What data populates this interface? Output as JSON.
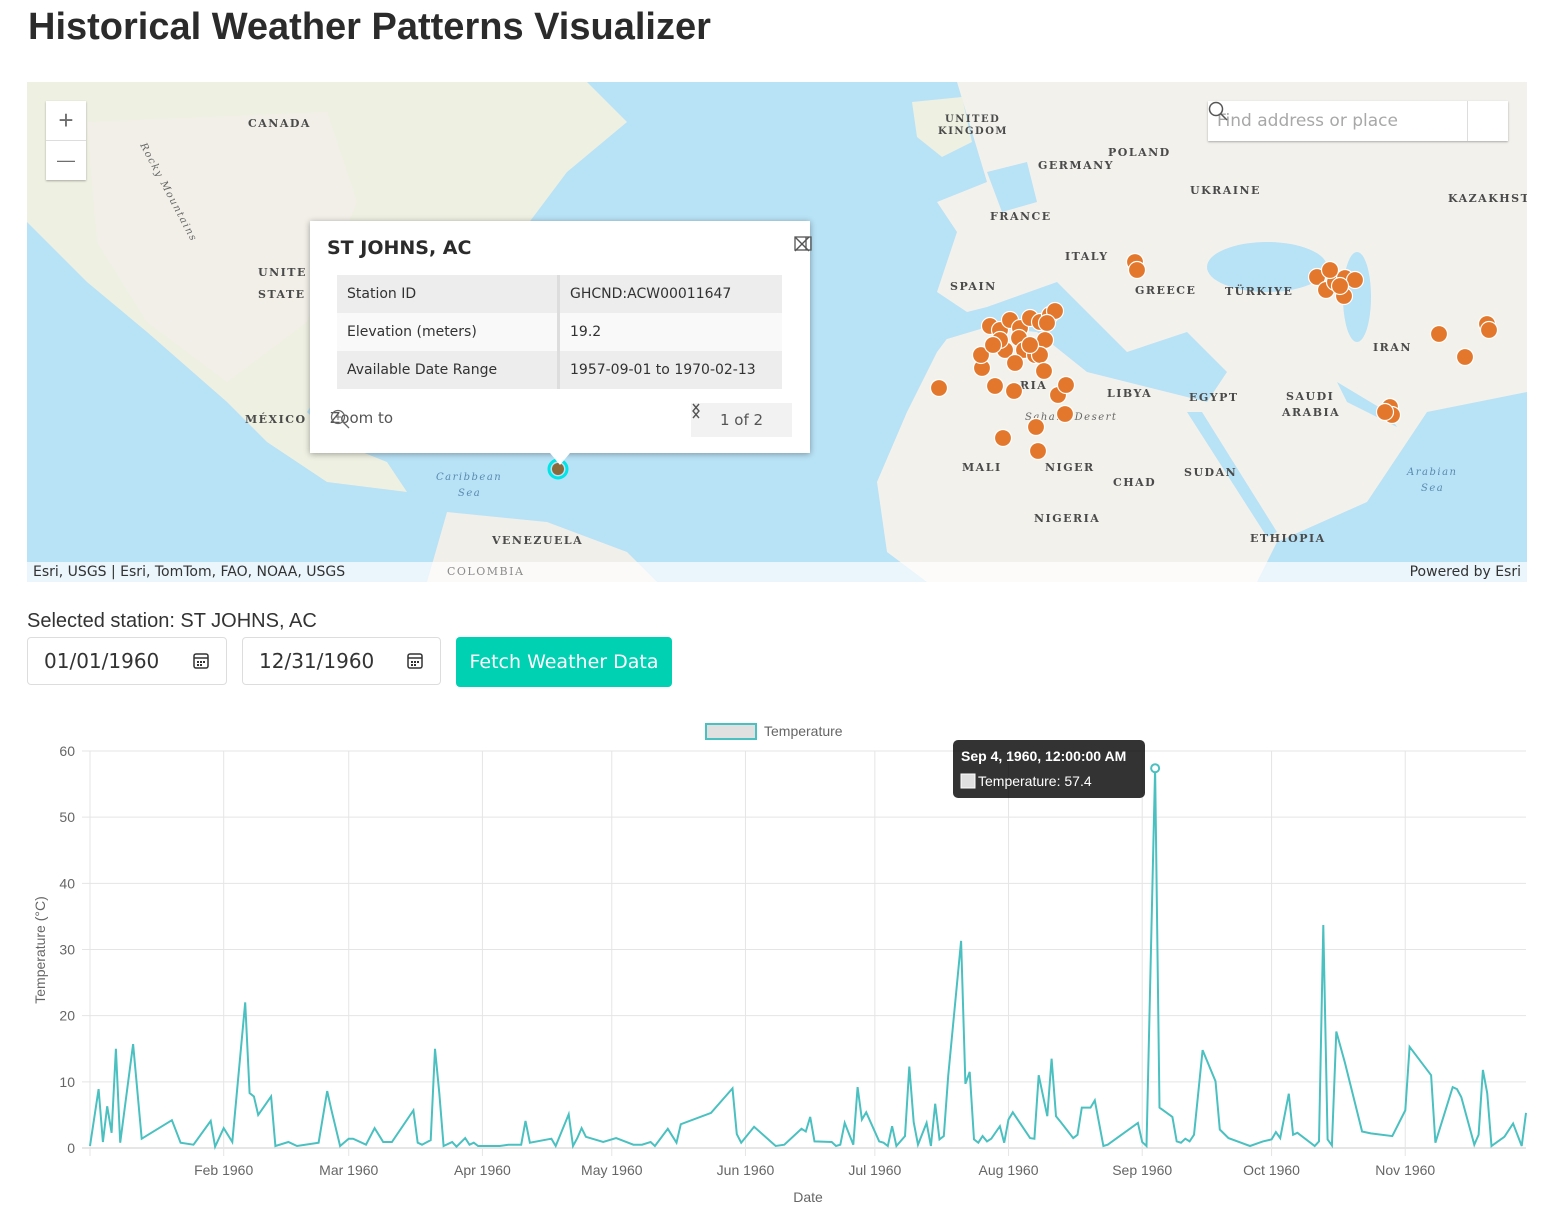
{
  "title": "Historical Weather Patterns Visualizer",
  "map": {
    "zoom_in": "+",
    "zoom_out": "—",
    "search_placeholder": "Find address or place",
    "attribution": "Esri, USGS | Esri, TomTom, FAO, NOAA, USGS",
    "powered_by": "Powered by Esri",
    "labels": {
      "canada": "CANADA",
      "rocky": "Rocky Mountains",
      "united": "UNITE",
      "states": "STATE",
      "mexico": "MÉXICO",
      "caribbean1": "Caribbean",
      "caribbean2": "Sea",
      "venezuela": "VENEZUELA",
      "colombia": "COLOMBIA",
      "uk1": "UNITED",
      "uk2": "KINGDOM",
      "poland": "POLAND",
      "germany": "GERMANY",
      "ukraine": "UKRAINE",
      "kazakhstan": "KAZAKHSTAN",
      "france": "FRANCE",
      "italy": "ITALY",
      "spain": "SPAIN",
      "greece": "GREECE",
      "turkiye": "TÜRKIYE",
      "iran": "IRAN",
      "libya": "LIBYA",
      "egypt": "EGYPT",
      "saudi1": "SAUDI",
      "saudi2": "ARABIA",
      "algeria": "RIA",
      "sahara": "Sahara Desert",
      "mali": "MALI",
      "niger": "NIGER",
      "chad": "CHAD",
      "sudan": "SUDAN",
      "nigeria": "NIGERIA",
      "ethiopia": "ETHIOPIA",
      "arabian1": "Arabian",
      "arabian2": "Sea"
    },
    "marker_color": "#e3772b",
    "selected_marker_color": "#00e5e5",
    "popup": {
      "title": "ST JOHNS, AC",
      "rows": [
        {
          "label": "Station ID",
          "value": "GHCND:ACW00011647"
        },
        {
          "label": "Elevation (meters)",
          "value": "19.2"
        },
        {
          "label": "Available Date Range",
          "value": "1957-09-01 to 1970-02-13"
        }
      ],
      "zoom_to": "Zoom to",
      "pager": "1 of 2"
    }
  },
  "controls": {
    "selected_station": "Selected station: ST JOHNS, AC",
    "start_date": "01/01/1960",
    "end_date": "12/31/1960",
    "fetch_label": "Fetch Weather Data",
    "accent": "#00d1b2"
  },
  "chart_data": {
    "type": "line",
    "xlabel": "Date",
    "ylabel": "Temperature (°C)",
    "ylim": [
      0,
      60
    ],
    "yticks": [
      0,
      10,
      20,
      30,
      40,
      50,
      60
    ],
    "xlim": [
      "1960-01-01",
      "1960-11-29"
    ],
    "xtick_labels": [
      {
        "date": "1960-02-01",
        "label": "Feb 1960"
      },
      {
        "date": "1960-03-01",
        "label": "Mar 1960"
      },
      {
        "date": "1960-04-01",
        "label": "Apr 1960"
      },
      {
        "date": "1960-05-01",
        "label": "May 1960"
      },
      {
        "date": "1960-06-01",
        "label": "Jun 1960"
      },
      {
        "date": "1960-07-01",
        "label": "Jul 1960"
      },
      {
        "date": "1960-08-01",
        "label": "Aug 1960"
      },
      {
        "date": "1960-09-01",
        "label": "Sep 1960"
      },
      {
        "date": "1960-10-01",
        "label": "Oct 1960"
      },
      {
        "date": "1960-11-01",
        "label": "Nov 1960"
      }
    ],
    "grid": true,
    "legend_position": "top",
    "series": [
      {
        "name": "Temperature",
        "color": "#4bc0c0",
        "points": [
          [
            "1960-01-01",
            0.3
          ],
          [
            "1960-01-03",
            8.9
          ],
          [
            "1960-01-04",
            0.9
          ],
          [
            "1960-01-05",
            6.3
          ],
          [
            "1960-01-06",
            2.3
          ],
          [
            "1960-01-07",
            15
          ],
          [
            "1960-01-08",
            0.8
          ],
          [
            "1960-01-11",
            15.7
          ],
          [
            "1960-01-13",
            1.4
          ],
          [
            "1960-01-20",
            4.2
          ],
          [
            "1960-01-22",
            0.8
          ],
          [
            "1960-01-25",
            0.5
          ],
          [
            "1960-01-29",
            4.1
          ],
          [
            "1960-01-30",
            0.2
          ],
          [
            "1960-02-01",
            3
          ],
          [
            "1960-02-03",
            0.9
          ],
          [
            "1960-02-06",
            22
          ],
          [
            "1960-02-07",
            8.3
          ],
          [
            "1960-02-08",
            7.8
          ],
          [
            "1960-02-09",
            5
          ],
          [
            "1960-02-12",
            7.8
          ],
          [
            "1960-02-13",
            0.3
          ],
          [
            "1960-02-16",
            0.9
          ],
          [
            "1960-02-18",
            0.3
          ],
          [
            "1960-02-23",
            0.8
          ],
          [
            "1960-02-25",
            8.6
          ],
          [
            "1960-02-26",
            5.7
          ],
          [
            "1960-02-28",
            0.3
          ],
          [
            "1960-03-01",
            1.4
          ],
          [
            "1960-03-02",
            1.4
          ],
          [
            "1960-03-05",
            0.5
          ],
          [
            "1960-03-07",
            3
          ],
          [
            "1960-03-09",
            0.9
          ],
          [
            "1960-03-11",
            0.9
          ],
          [
            "1960-03-16",
            5.7
          ],
          [
            "1960-03-17",
            0.8
          ],
          [
            "1960-03-18",
            0.5
          ],
          [
            "1960-03-20",
            1.2
          ],
          [
            "1960-03-21",
            15
          ],
          [
            "1960-03-22",
            8.3
          ],
          [
            "1960-03-23",
            0.3
          ],
          [
            "1960-03-25",
            0.9
          ],
          [
            "1960-03-26",
            0.2
          ],
          [
            "1960-03-28",
            1.5
          ],
          [
            "1960-03-29",
            0.5
          ],
          [
            "1960-03-30",
            0.8
          ],
          [
            "1960-03-31",
            0.3
          ],
          [
            "1960-04-05",
            0.3
          ],
          [
            "1960-04-07",
            0.5
          ],
          [
            "1960-04-10",
            0.5
          ],
          [
            "1960-04-11",
            4.1
          ],
          [
            "1960-04-12",
            0.8
          ],
          [
            "1960-04-17",
            1.4
          ],
          [
            "1960-04-18",
            0.3
          ],
          [
            "1960-04-21",
            5.1
          ],
          [
            "1960-04-22",
            0.3
          ],
          [
            "1960-04-23",
            1.5
          ],
          [
            "1960-04-24",
            3
          ],
          [
            "1960-04-25",
            1.7
          ],
          [
            "1960-04-29",
            0.9
          ],
          [
            "1960-05-02",
            1.5
          ],
          [
            "1960-05-06",
            0.5
          ],
          [
            "1960-05-08",
            0.5
          ],
          [
            "1960-05-10",
            0.9
          ],
          [
            "1960-05-11",
            0.3
          ],
          [
            "1960-05-14",
            2.9
          ],
          [
            "1960-05-16",
            0.8
          ],
          [
            "1960-05-17",
            3.6
          ],
          [
            "1960-05-24",
            5.3
          ],
          [
            "1960-05-29",
            9
          ],
          [
            "1960-05-30",
            2.1
          ],
          [
            "1960-05-31",
            0.8
          ],
          [
            "1960-06-03",
            3.2
          ],
          [
            "1960-06-08",
            0.3
          ],
          [
            "1960-06-10",
            0.5
          ],
          [
            "1960-06-14",
            2.9
          ],
          [
            "1960-06-15",
            2.5
          ],
          [
            "1960-06-16",
            4.7
          ],
          [
            "1960-06-17",
            1
          ],
          [
            "1960-06-21",
            0.9
          ],
          [
            "1960-06-22",
            0.3
          ],
          [
            "1960-06-23",
            0.5
          ],
          [
            "1960-06-24",
            3.8
          ],
          [
            "1960-06-26",
            0.5
          ],
          [
            "1960-06-27",
            9.2
          ],
          [
            "1960-06-28",
            4.3
          ],
          [
            "1960-06-29",
            5.4
          ],
          [
            "1960-07-02",
            1
          ],
          [
            "1960-07-03",
            0.8
          ],
          [
            "1960-07-04",
            0.3
          ],
          [
            "1960-07-05",
            3.3
          ],
          [
            "1960-07-06",
            0.3
          ],
          [
            "1960-07-08",
            1.8
          ],
          [
            "1960-07-09",
            12.3
          ],
          [
            "1960-07-10",
            3.9
          ],
          [
            "1960-07-11",
            0.5
          ],
          [
            "1960-07-13",
            3.8
          ],
          [
            "1960-07-14",
            0.3
          ],
          [
            "1960-07-15",
            6.7
          ],
          [
            "1960-07-16",
            1.3
          ],
          [
            "1960-07-17",
            1.8
          ],
          [
            "1960-07-18",
            10.9
          ],
          [
            "1960-07-21",
            31.3
          ],
          [
            "1960-07-22",
            9.7
          ],
          [
            "1960-07-23",
            11.5
          ],
          [
            "1960-07-24",
            1.3
          ],
          [
            "1960-07-25",
            0.8
          ],
          [
            "1960-07-26",
            1.8
          ],
          [
            "1960-07-27",
            1
          ],
          [
            "1960-07-28",
            1.4
          ],
          [
            "1960-07-30",
            3.3
          ],
          [
            "1960-07-31",
            0.8
          ],
          [
            "1960-08-01",
            4.3
          ],
          [
            "1960-08-02",
            5.4
          ],
          [
            "1960-08-06",
            1.5
          ],
          [
            "1960-08-07",
            1.4
          ],
          [
            "1960-08-08",
            11
          ],
          [
            "1960-08-10",
            4.8
          ],
          [
            "1960-08-11",
            13.5
          ],
          [
            "1960-08-12",
            4.8
          ],
          [
            "1960-08-13",
            4
          ],
          [
            "1960-08-16",
            1.5
          ],
          [
            "1960-08-17",
            2
          ],
          [
            "1960-08-18",
            6.1
          ],
          [
            "1960-08-20",
            6.1
          ],
          [
            "1960-08-21",
            7.2
          ],
          [
            "1960-08-23",
            0.3
          ],
          [
            "1960-08-24",
            0.5
          ],
          [
            "1960-08-31",
            3.8
          ],
          [
            "1960-09-01",
            0.9
          ],
          [
            "1960-09-02",
            0.3
          ],
          [
            "1960-09-04",
            57.4
          ],
          [
            "1960-09-05",
            6.1
          ],
          [
            "1960-09-08",
            4.7
          ],
          [
            "1960-09-09",
            1
          ],
          [
            "1960-09-10",
            0.8
          ],
          [
            "1960-09-11",
            1.4
          ],
          [
            "1960-09-12",
            1
          ],
          [
            "1960-09-13",
            2
          ],
          [
            "1960-09-15",
            14.8
          ],
          [
            "1960-09-18",
            10.1
          ],
          [
            "1960-09-19",
            2.8
          ],
          [
            "1960-09-21",
            1.5
          ],
          [
            "1960-09-26",
            0.3
          ],
          [
            "1960-09-29",
            1
          ],
          [
            "1960-10-01",
            1.3
          ],
          [
            "1960-10-02",
            2.4
          ],
          [
            "1960-10-03",
            1.5
          ],
          [
            "1960-10-05",
            8.2
          ],
          [
            "1960-10-06",
            2
          ],
          [
            "1960-10-07",
            2.3
          ],
          [
            "1960-10-11",
            0.3
          ],
          [
            "1960-10-12",
            1
          ],
          [
            "1960-10-13",
            33.7
          ],
          [
            "1960-10-14",
            1.3
          ],
          [
            "1960-10-15",
            0.4
          ],
          [
            "1960-10-16",
            17.6
          ],
          [
            "1960-10-18",
            12.9
          ],
          [
            "1960-10-22",
            2.5
          ],
          [
            "1960-10-24",
            2.2
          ],
          [
            "1960-10-29",
            1.8
          ],
          [
            "1960-11-01",
            5.7
          ],
          [
            "1960-11-02",
            15.3
          ],
          [
            "1960-11-07",
            11
          ],
          [
            "1960-11-08",
            0.8
          ],
          [
            "1960-11-12",
            9.2
          ],
          [
            "1960-11-13",
            8.9
          ],
          [
            "1960-11-14",
            7.7
          ],
          [
            "1960-11-17",
            0.5
          ],
          [
            "1960-11-18",
            2
          ],
          [
            "1960-11-19",
            11.8
          ],
          [
            "1960-11-20",
            8.3
          ],
          [
            "1960-11-21",
            0.3
          ],
          [
            "1960-11-24",
            1.7
          ],
          [
            "1960-11-26",
            3.7
          ],
          [
            "1960-11-28",
            0.3
          ],
          [
            "1960-11-29",
            5.3
          ]
        ]
      }
    ],
    "tooltip": {
      "title": "Sep 4, 1960, 12:00:00 AM",
      "label": "Temperature: 57.4",
      "date": "1960-09-04",
      "value": 57.4
    }
  }
}
